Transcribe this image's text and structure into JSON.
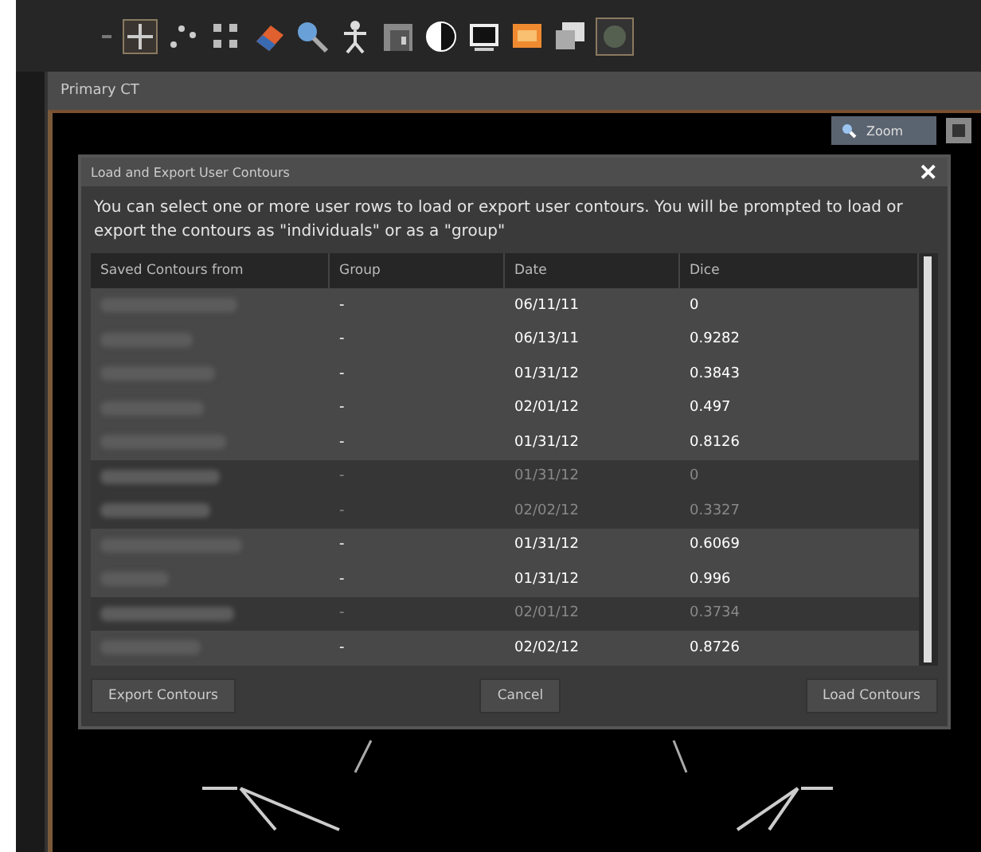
{
  "viewer": {
    "tab_title": "Primary CT",
    "zoom_button": "Zoom"
  },
  "dialog": {
    "title": "Load and Export User Contours",
    "close": "✕",
    "description": "You can select one or more user rows to load or export user contours. You will be prompted to load or export the contours as \"individuals\" or as a \"group\"",
    "table": {
      "columns": [
        "Saved Contours from",
        "Group",
        "Date",
        "Dice"
      ],
      "rows": [
        {
          "group": "-",
          "date": "06/11/11",
          "dice": "0",
          "dimmed": false
        },
        {
          "group": "-",
          "date": "06/13/11",
          "dice": "0.9282",
          "dimmed": false
        },
        {
          "group": "-",
          "date": "01/31/12",
          "dice": "0.3843",
          "dimmed": false
        },
        {
          "group": "-",
          "date": "02/01/12",
          "dice": "0.497",
          "dimmed": false
        },
        {
          "group": "-",
          "date": "01/31/12",
          "dice": "0.8126",
          "dimmed": false
        },
        {
          "group": "-",
          "date": "01/31/12",
          "dice": "0",
          "dimmed": true
        },
        {
          "group": "-",
          "date": "02/02/12",
          "dice": "0.3327",
          "dimmed": true
        },
        {
          "group": "-",
          "date": "01/31/12",
          "dice": "0.6069",
          "dimmed": false
        },
        {
          "group": "-",
          "date": "01/31/12",
          "dice": "0.996",
          "dimmed": false
        },
        {
          "group": "-",
          "date": "02/01/12",
          "dice": "0.3734",
          "dimmed": true
        },
        {
          "group": "-",
          "date": "02/02/12",
          "dice": "0.8726",
          "dimmed": false
        }
      ]
    },
    "buttons": [
      "Export Contours",
      "Cancel",
      "Load Contours"
    ]
  }
}
